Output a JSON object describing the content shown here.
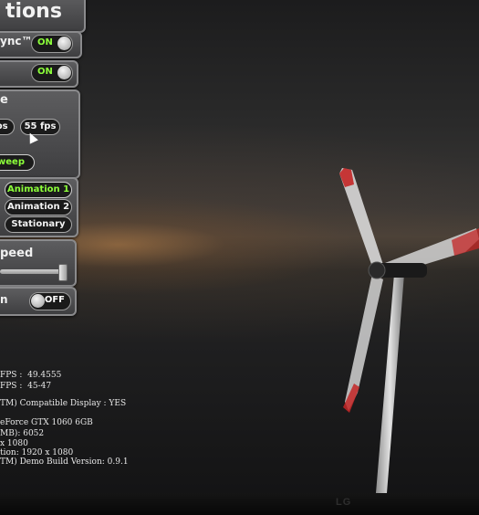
{
  "panel": {
    "title": "tions",
    "vsync_label": "ync™",
    "vsync_state": "ON",
    "second_toggle_state": "ON",
    "fps_section_label": "e",
    "fps_option_left": "ps",
    "fps_option_selected": "55 fps",
    "sweep_label": "weep",
    "animation_options": [
      "Animation 1",
      "Animation 2",
      "Stationary"
    ],
    "animation_selected": "Animation 1",
    "speed_label": "peed",
    "speed_level": 1.0,
    "last_toggle_label": "n",
    "last_toggle_state": "OFF"
  },
  "stats": {
    "line1_label": "FPS :",
    "line1_value": "49.4555",
    "line2_label": "FPS :",
    "line2_value": "45-47",
    "line3": "TM) Compatible Display : YES",
    "line4": "eForce GTX 1060 6GB",
    "line5": "MB): 6052",
    "line6": "x 1080",
    "line7": "tion: 1920 x 1080",
    "line8": "TM) Demo Build Version: 0.9.1"
  },
  "monitor": {
    "brand": "LG"
  },
  "colors": {
    "on_green": "#8cff3a",
    "panel_gray": "#4c4c4e",
    "blade_red": "#c42626"
  }
}
